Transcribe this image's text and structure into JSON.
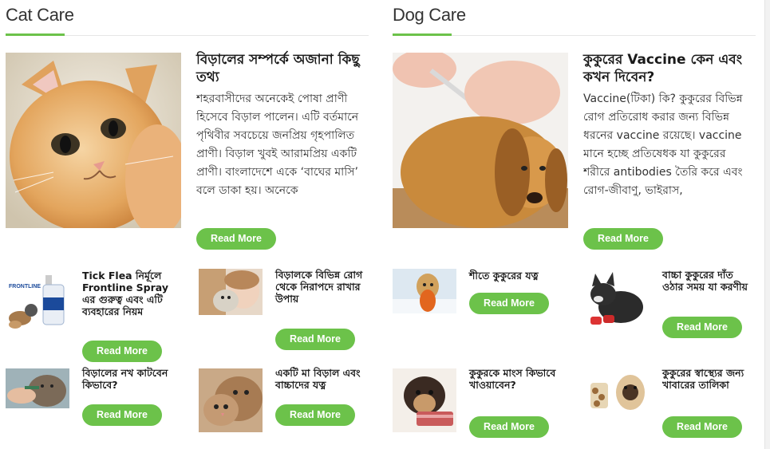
{
  "cat_section": {
    "title": "Cat Care",
    "featured": {
      "image_icon": "orange-kitten-photo",
      "title": "বিড়ালের সম্পর্কে অজানা কিছু তথ্য",
      "excerpt": "শহরবাসীদের অনেকেই পোষা প্রাণী হিসেবে বিড়াল পালেন। এটি বর্তমানে পৃথিবীর সবচেয়ে জনপ্রিয় গৃহপালিত প্রাণী। বিড়াল খুবই আরামপ্রিয় একটি প্রাণী। বাংলাদেশে একে ‘বাঘের মাসি’ বলে ডাকা হয়। অনেকে",
      "button": "Read More"
    },
    "items": [
      {
        "image_icon": "frontline-spray-photo",
        "title": "Tick Flea নির্মূলে Frontline Spray এর গুরুত্ব এবং এটি ব্যবহারের নিয়ম",
        "button": "Read More"
      },
      {
        "image_icon": "woman-with-cat-photo",
        "title": "বিড়ালকে বিভিন্ন রোগ থেকে নিরাপদে রাখার উপায়",
        "button": "Read More"
      },
      {
        "image_icon": "cat-nail-clipping-photo",
        "title": "বিড়ালের নখ কাটবেন কিভাবে?",
        "button": "Read More"
      },
      {
        "image_icon": "mother-cat-kitten-photo",
        "title": "একটি মা বিড়াল এবং বাচ্চাদের যত্ন",
        "button": "Read More"
      }
    ]
  },
  "dog_section": {
    "title": "Dog Care",
    "featured": {
      "image_icon": "puppy-vaccine-photo",
      "title": "কুকুরের Vaccine কেন এবং কখন দিবেন?",
      "excerpt": "Vaccine(টিকা) কি? কুকুরের বিভিন্ন রোগ প্রতিরোধ করার জন্য বিভিন্ন ধরনের vaccine রয়েছে। vaccine মানে হচ্ছে প্রতিষেধক যা কুকুরের শরীরে antibodies তৈরি করে এবং রোগ-জীবাণু, ভাইরাস,",
      "button": "Read More"
    },
    "items": [
      {
        "image_icon": "dog-in-snow-scarf-photo",
        "title": "শীতে কুকুরের যত্ন",
        "button": "Read More"
      },
      {
        "image_icon": "french-bulldog-puppy-photo",
        "title": "বাচ্চা কুকুরের দাঁত ওঠার সময় যা করণীয়",
        "button": "Read More"
      },
      {
        "image_icon": "puppy-eating-meat-photo",
        "title": "কুকুরকে মাংস কিভাবে খাওয়াবেন?",
        "button": "Read More"
      },
      {
        "image_icon": "pug-with-treats-photo",
        "title": "কুকুরের স্বাস্থ্যের জন্য খাবারের তালিকা",
        "button": "Read More"
      }
    ]
  },
  "colors": {
    "accent": "#6cc24a",
    "text": "#222222",
    "rule": "#e6e6e6"
  }
}
